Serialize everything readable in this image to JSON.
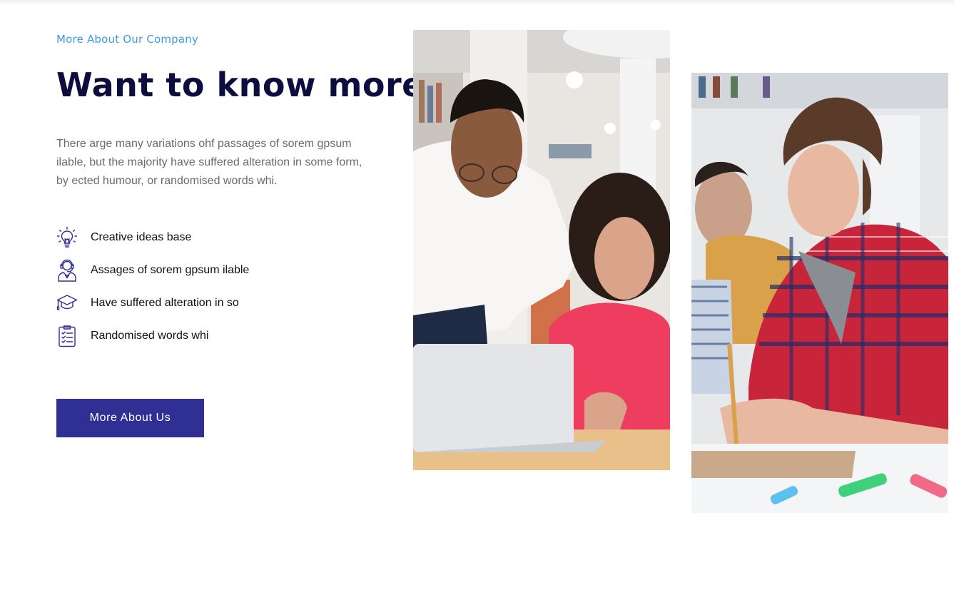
{
  "section": {
    "eyebrow": "More About Our Company",
    "title": "Want to know more",
    "description": "There arge many variations ohf passages of sorem gpsum ilable, but the majority have suffered alteration in some form, by ected humour, or randomised words whi."
  },
  "features": [
    {
      "icon": "lightbulb-icon",
      "label": "Creative ideas base"
    },
    {
      "icon": "support-agent-icon",
      "label": "Assages of sorem gpsum ilable"
    },
    {
      "icon": "graduation-cap-icon",
      "label": "Have suffered alteration in so"
    },
    {
      "icon": "clipboard-checklist-icon",
      "label": "Randomised words whi"
    }
  ],
  "cta": {
    "label": "More About Us"
  },
  "colors": {
    "accent": "#3e9be6",
    "heading": "#0d0d3f",
    "button": "#2f2f94",
    "icon_stroke": "#2f2f94"
  }
}
